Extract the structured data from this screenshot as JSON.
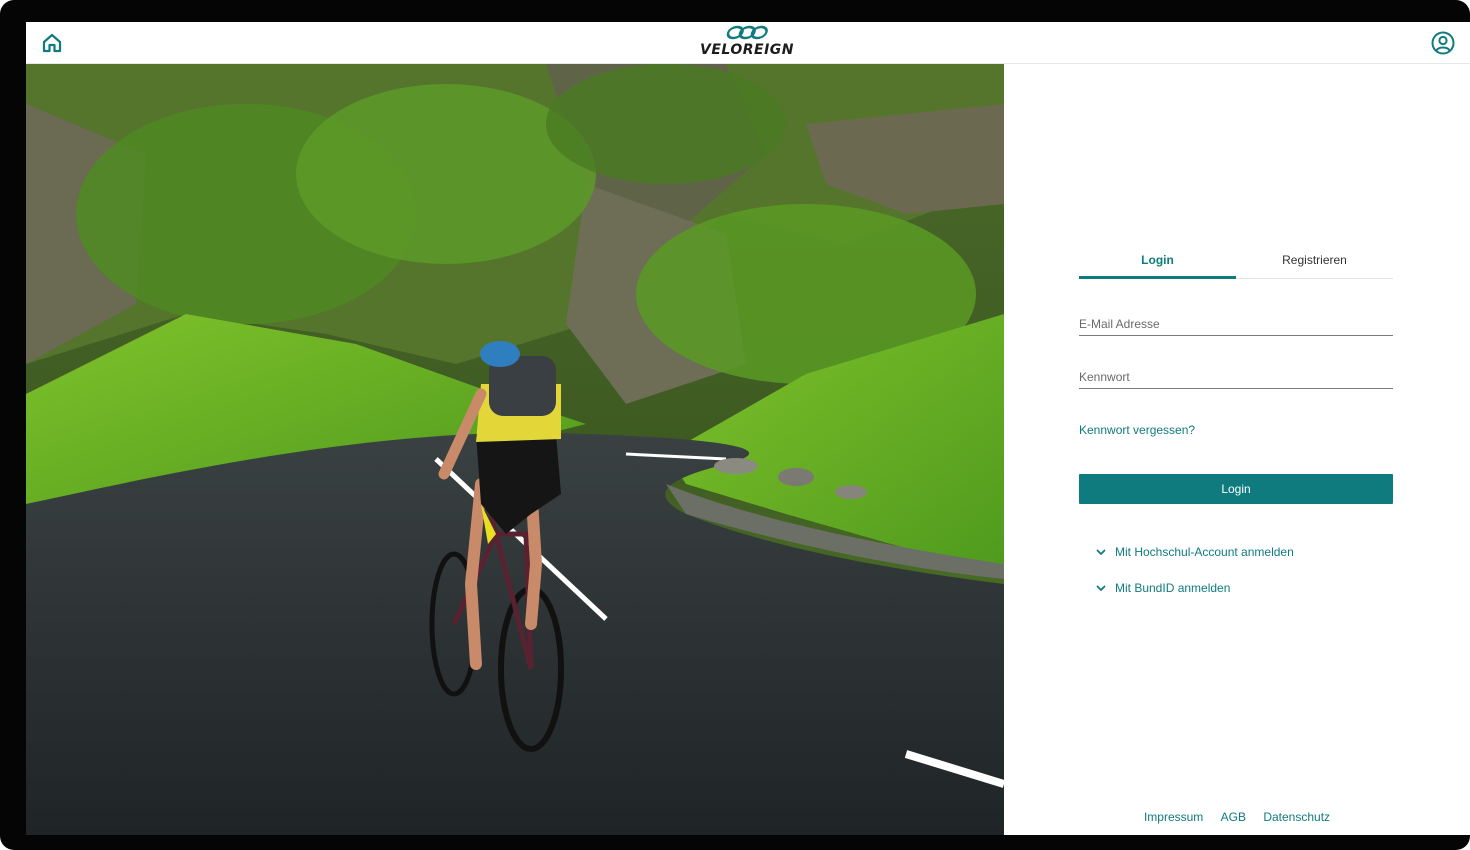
{
  "header": {
    "brand_name": "VELOREIGN",
    "home_icon": "home-icon",
    "profile_icon": "user-circle-icon"
  },
  "colors": {
    "accent": "#0f7b7e",
    "text": "#333333",
    "frame": "#050505"
  },
  "hero": {
    "image": "cyclist-on-mountain-road"
  },
  "auth": {
    "tabs": [
      {
        "label": "Login",
        "active": true
      },
      {
        "label": "Registrieren",
        "active": false
      }
    ],
    "email_placeholder": "E-Mail Adresse",
    "password_placeholder": "Kennwort",
    "forgot_password": "Kennwort vergessen?",
    "login_button": "Login",
    "alt_logins": [
      {
        "label": "Mit Hochschul-Account anmelden",
        "icon": "chevron-down-icon"
      },
      {
        "label": "Mit BundID anmelden",
        "icon": "chevron-down-icon"
      }
    ]
  },
  "footer": {
    "links": [
      "Impressum",
      "AGB",
      "Datenschutz"
    ]
  }
}
